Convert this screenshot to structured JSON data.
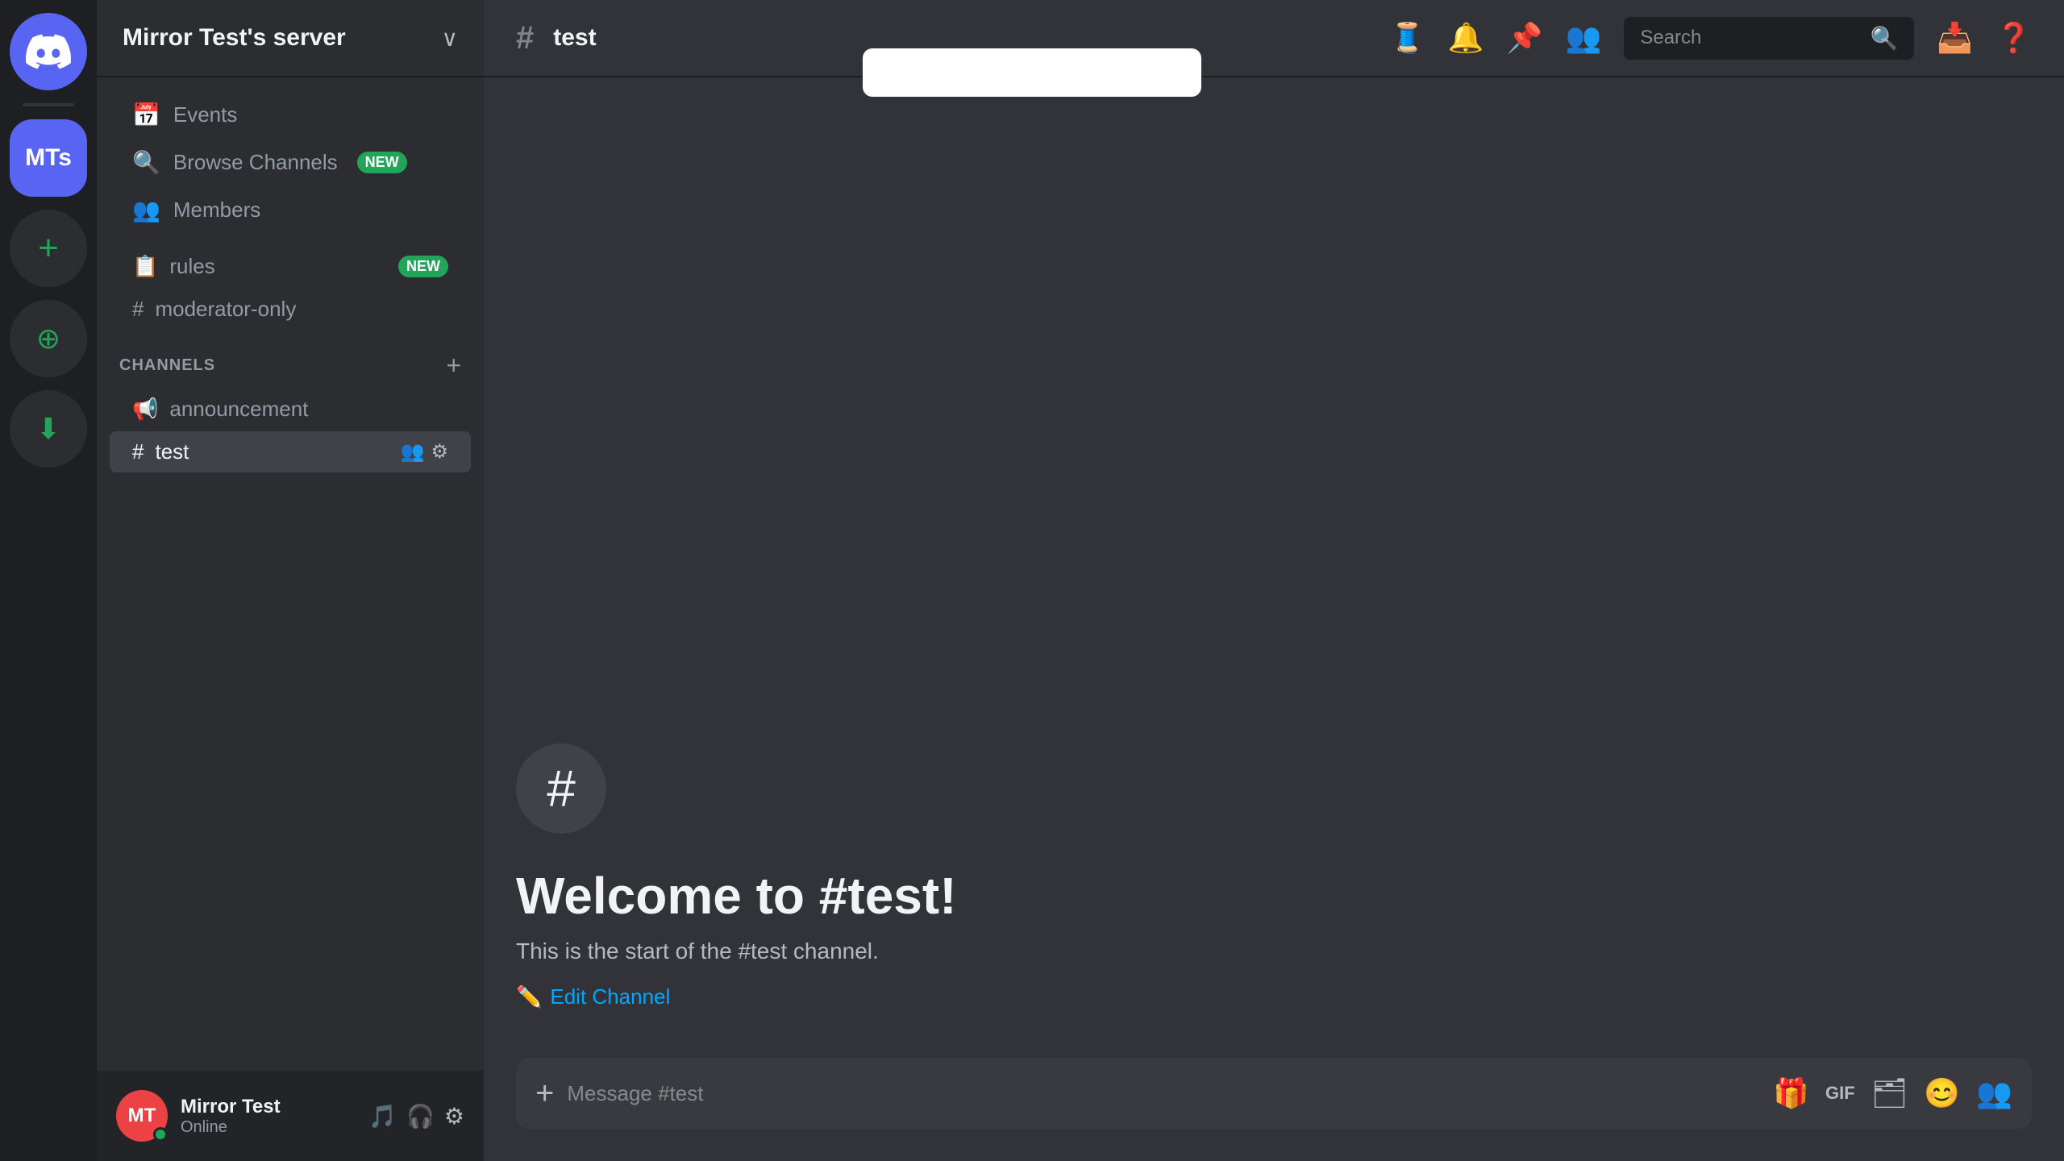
{
  "app": {
    "title": "Discord"
  },
  "server_rail": {
    "discord_icon": "discord-logo",
    "server_initials": "MTs",
    "add_label": "+",
    "explore_label": "⊕",
    "download_label": "⬇"
  },
  "sidebar": {
    "server_name": "Mirror Test's server",
    "chevron": "∨",
    "nav_items": [
      {
        "id": "events",
        "icon": "📅",
        "label": "Events"
      },
      {
        "id": "browse-channels",
        "icon": "🔍",
        "label": "Browse Channels",
        "badge": "NEW"
      },
      {
        "id": "members",
        "icon": "👥",
        "label": "Members"
      }
    ],
    "uncategorized_channels": [
      {
        "id": "rules",
        "icon": "📋",
        "label": "rules",
        "badge": "NEW"
      },
      {
        "id": "moderator-only",
        "icon": "#",
        "label": "moderator-only"
      }
    ],
    "channels_section": {
      "title": "CHANNELS",
      "add_icon": "+"
    },
    "channels": [
      {
        "id": "announcement",
        "icon": "📢",
        "label": "announcement",
        "active": false
      },
      {
        "id": "test",
        "icon": "#",
        "label": "test",
        "active": true,
        "actions": [
          "👥",
          "⚙"
        ]
      }
    ],
    "user": {
      "name": "Mirror Test",
      "status": "Online",
      "initials": "MT",
      "controls": [
        "🎵",
        "🎧",
        "⚙"
      ]
    }
  },
  "topbar": {
    "channel_hash": "#",
    "channel_name": "test",
    "actions": [
      {
        "id": "threads",
        "icon": "🧵"
      },
      {
        "id": "notifications",
        "icon": "🔔"
      },
      {
        "id": "pinned",
        "icon": "📌"
      },
      {
        "id": "members",
        "icon": "👥"
      }
    ],
    "search": {
      "placeholder": "Search",
      "icon": "🔍"
    },
    "extra_icons": [
      {
        "id": "inbox",
        "icon": "📥"
      },
      {
        "id": "help",
        "icon": "❓"
      }
    ]
  },
  "welcome": {
    "icon": "#",
    "title": "Welcome to #test!",
    "description": "This is the start of the #test channel.",
    "edit_channel": "Edit Channel"
  },
  "message_input": {
    "placeholder": "Message #test",
    "add_icon": "+",
    "bottom_actions": [
      {
        "id": "gift",
        "icon": "🎁"
      },
      {
        "id": "gif",
        "icon": "GIF"
      },
      {
        "id": "sticker",
        "icon": "🗂"
      },
      {
        "id": "emoji",
        "icon": "😊"
      },
      {
        "id": "members2",
        "icon": "👥"
      }
    ]
  },
  "popup": {
    "visible": true
  }
}
